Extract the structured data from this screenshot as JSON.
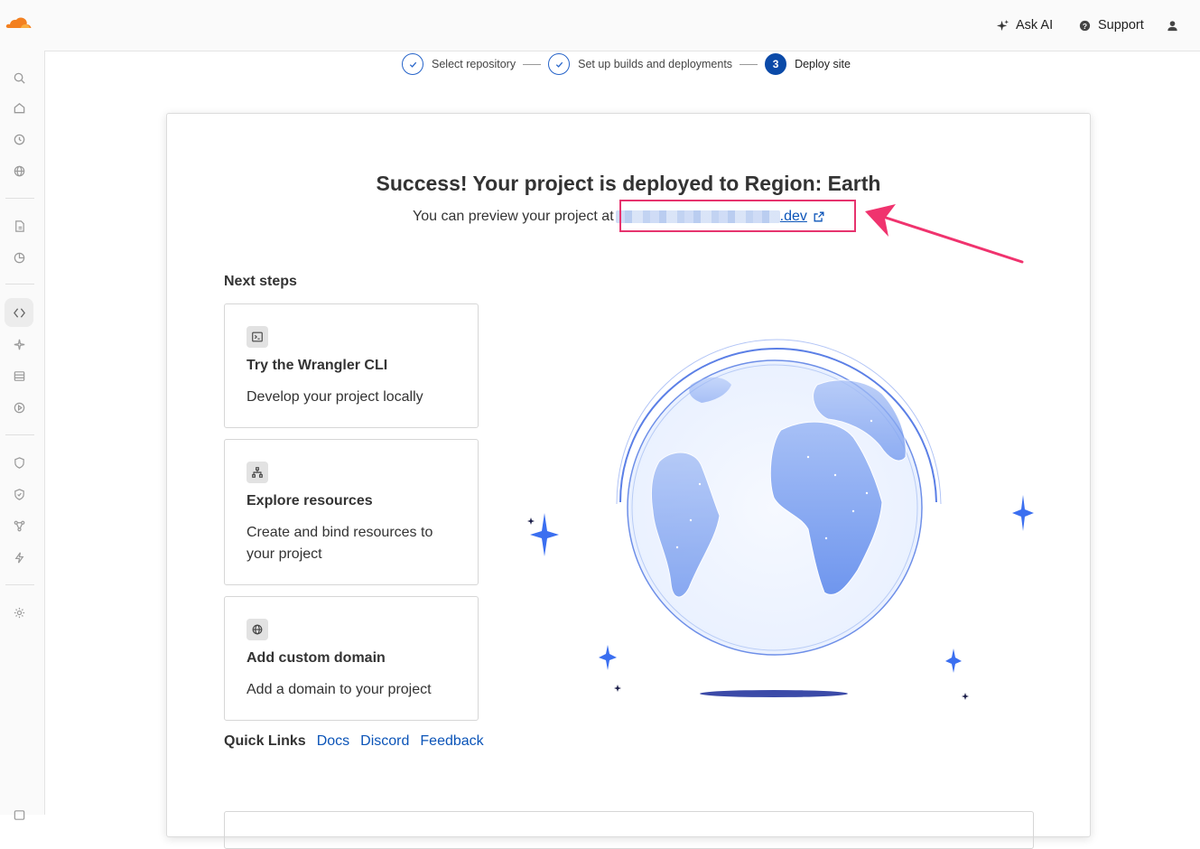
{
  "brand": {
    "logo_icon": "cloudflare-logo-icon",
    "accent": "#f38020"
  },
  "header": {
    "ask_ai_label": "Ask AI",
    "support_label": "Support",
    "icons": [
      "sparkle-icon",
      "help-icon",
      "user-icon"
    ]
  },
  "sidebar": {
    "items": [
      {
        "icon": "search-icon"
      },
      {
        "icon": "home-icon"
      },
      {
        "icon": "history-icon"
      },
      {
        "icon": "globe-icon"
      },
      {
        "icon": "document-icon"
      },
      {
        "icon": "chart-pie-icon"
      },
      {
        "icon": "code-icon",
        "active": true
      },
      {
        "icon": "ai-sparkle-icon"
      },
      {
        "icon": "storage-icon"
      },
      {
        "icon": "media-play-icon"
      },
      {
        "icon": "shield-icon"
      },
      {
        "icon": "shield-check-icon"
      },
      {
        "icon": "network-icon"
      },
      {
        "icon": "bolt-icon"
      },
      {
        "icon": "settings-icon"
      }
    ]
  },
  "stepper": {
    "steps": [
      {
        "label": "Select repository",
        "state": "complete"
      },
      {
        "label": "Set up builds and deployments",
        "state": "complete"
      },
      {
        "label": "Deploy site",
        "number": "3",
        "state": "current"
      }
    ]
  },
  "main": {
    "title": "Success! Your project is deployed to Region: Earth",
    "preview_prefix": "You can preview your project at",
    "preview_link_suffix": ".dev",
    "next_steps_heading": "Next steps",
    "cards": [
      {
        "title": "Try the Wrangler CLI",
        "desc": "Develop your project locally",
        "icon": "terminal-icon"
      },
      {
        "title": "Explore resources",
        "desc": "Create and bind resources to your project",
        "icon": "hierarchy-icon"
      },
      {
        "title": "Add custom domain",
        "desc": "Add a domain to your project",
        "icon": "globe-icon"
      }
    ],
    "quick_links": {
      "label": "Quick Links",
      "links": [
        "Docs",
        "Discord",
        "Feedback"
      ]
    }
  },
  "annotation": {
    "highlight_color": "#e6336e"
  }
}
